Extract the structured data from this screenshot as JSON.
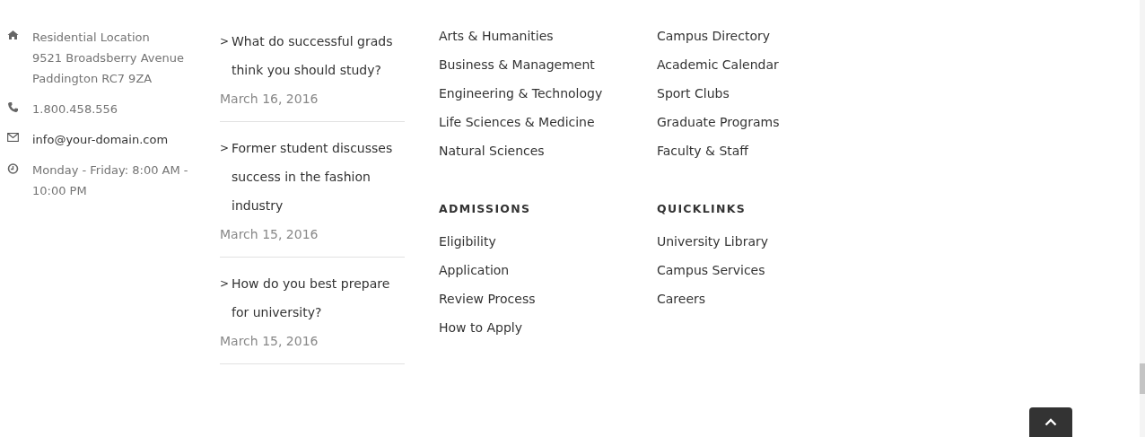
{
  "contact": [
    {
      "kind": "home",
      "lines": [
        "Residential Location",
        "9521 Broadsberry Avenue",
        "Paddington RC7 9ZA"
      ],
      "link": false
    },
    {
      "kind": "phone",
      "lines": [
        "1.800.458.556"
      ],
      "link": false
    },
    {
      "kind": "mail",
      "lines": [
        "info@your-domain.com"
      ],
      "link": true
    },
    {
      "kind": "clock",
      "lines": [
        "Monday - Friday: 8:00 AM - 10:00 PM"
      ],
      "link": false
    }
  ],
  "posts": [
    {
      "marker": ">",
      "title": "What do successful grads think you should study?",
      "date": "March 16, 2016"
    },
    {
      "marker": ">",
      "title": "Former student discusses success in the fashion industry",
      "date": "March 15, 2016"
    },
    {
      "marker": ">",
      "title": "How do you best prepare for university?",
      "date": "March 15, 2016"
    }
  ],
  "link_columns": [
    [
      {
        "links": [
          "Arts & Humanities",
          "Business & Management",
          "Engineering & Technology",
          "Life Sciences & Medicine",
          "Natural Sciences"
        ]
      },
      {
        "heading": "ADMISSIONS",
        "links": [
          "Eligibility",
          "Application",
          "Review Process",
          "How to Apply"
        ]
      }
    ],
    [
      {
        "links": [
          "Campus Directory",
          "Academic Calendar",
          "Sport Clubs",
          "Graduate Programs",
          "Faculty & Staff"
        ]
      },
      {
        "heading": "QUICKLINKS",
        "links": [
          "University Library",
          "Campus Services",
          "Careers"
        ]
      }
    ]
  ]
}
